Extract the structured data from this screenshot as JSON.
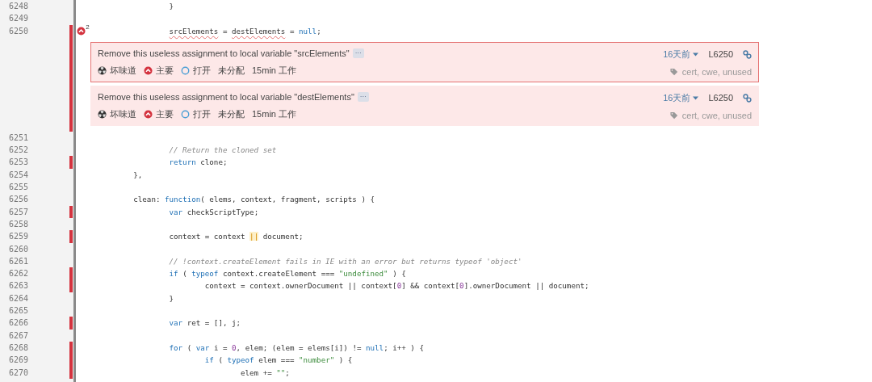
{
  "lines": [
    {
      "number": "6248",
      "uncovered": false,
      "tokens": [
        {
          "kind": "plain",
          "text": "\t\t}"
        }
      ]
    },
    {
      "number": "6249",
      "uncovered": false
    },
    {
      "number": "6250",
      "uncovered": true,
      "issue_count": "2",
      "tokens": [
        {
          "kind": "issue",
          "text": "\t\tsrcElements"
        },
        {
          "kind": "plain",
          "text": " = "
        },
        {
          "kind": "issue",
          "text": "destElements"
        },
        {
          "kind": "plain",
          "text": " = "
        },
        {
          "kind": "keyword",
          "text": "null"
        },
        {
          "kind": "plain",
          "text": ";"
        }
      ],
      "issues": [
        {
          "selected": true,
          "message": "Remove this useless assignment to local variable \"srcElements\"",
          "more": "···",
          "type": "坏味道",
          "severity": "主要",
          "status": "打开",
          "assignee": "未分配",
          "effort": "15min 工作",
          "age": "16天前",
          "line": "L6250",
          "tags": "cert, cwe, unused"
        },
        {
          "selected": false,
          "message": "Remove this useless assignment to local variable \"destElements\"",
          "more": "···",
          "type": "坏味道",
          "severity": "主要",
          "status": "打开",
          "assignee": "未分配",
          "effort": "15min 工作",
          "age": "16天前",
          "line": "L6250",
          "tags": "cert, cwe, unused"
        }
      ]
    },
    {
      "number": "6251",
      "uncovered": false
    },
    {
      "number": "6252",
      "uncovered": false,
      "tokens": [
        {
          "kind": "comment",
          "text": "\t\t// Return the cloned set"
        }
      ]
    },
    {
      "number": "6253",
      "uncovered": true,
      "tokens": [
        {
          "kind": "keyword",
          "text": "\t\treturn"
        },
        {
          "kind": "plain",
          "text": " clone;"
        }
      ]
    },
    {
      "number": "6254",
      "uncovered": false,
      "tokens": [
        {
          "kind": "plain",
          "text": "\t},"
        }
      ]
    },
    {
      "number": "6255",
      "uncovered": false
    },
    {
      "number": "6256",
      "uncovered": false,
      "tokens": [
        {
          "kind": "plain",
          "text": "\tclean: "
        },
        {
          "kind": "keyword",
          "text": "function"
        },
        {
          "kind": "plain",
          "text": "( elems, context, fragment, scripts ) {"
        }
      ]
    },
    {
      "number": "6257",
      "uncovered": true,
      "tokens": [
        {
          "kind": "keyword",
          "text": "\t\tvar"
        },
        {
          "kind": "plain",
          "text": " checkScriptType;"
        }
      ]
    },
    {
      "number": "6258",
      "uncovered": false
    },
    {
      "number": "6259",
      "uncovered": true,
      "tokens": [
        {
          "kind": "plain",
          "text": "\t\tcontext = context "
        },
        {
          "kind": "highlight",
          "text": "||"
        },
        {
          "kind": "plain",
          "text": " document;"
        }
      ]
    },
    {
      "number": "6260",
      "uncovered": false
    },
    {
      "number": "6261",
      "uncovered": false,
      "tokens": [
        {
          "kind": "comment",
          "text": "\t\t// !context.createElement fails in IE with an error but returns typeof 'object'"
        }
      ]
    },
    {
      "number": "6262",
      "uncovered": true,
      "tokens": [
        {
          "kind": "keyword",
          "text": "\t\tif"
        },
        {
          "kind": "plain",
          "text": " ( "
        },
        {
          "kind": "keyword",
          "text": "typeof"
        },
        {
          "kind": "plain",
          "text": " context.createElement === "
        },
        {
          "kind": "string",
          "text": "\"undefined\""
        },
        {
          "kind": "plain",
          "text": " ) {"
        }
      ]
    },
    {
      "number": "6263",
      "uncovered": true,
      "tokens": [
        {
          "kind": "plain",
          "text": "\t\t\tcontext = context.ownerDocument || context["
        },
        {
          "kind": "number",
          "text": "0"
        },
        {
          "kind": "plain",
          "text": "] && context["
        },
        {
          "kind": "number",
          "text": "0"
        },
        {
          "kind": "plain",
          "text": "].ownerDocument || document;"
        }
      ]
    },
    {
      "number": "6264",
      "uncovered": false,
      "tokens": [
        {
          "kind": "plain",
          "text": "\t\t}"
        }
      ]
    },
    {
      "number": "6265",
      "uncovered": false
    },
    {
      "number": "6266",
      "uncovered": true,
      "tokens": [
        {
          "kind": "keyword",
          "text": "\t\tvar"
        },
        {
          "kind": "plain",
          "text": " ret = [], j;"
        }
      ]
    },
    {
      "number": "6267",
      "uncovered": false
    },
    {
      "number": "6268",
      "uncovered": true,
      "tokens": [
        {
          "kind": "keyword",
          "text": "\t\tfor"
        },
        {
          "kind": "plain",
          "text": " ( "
        },
        {
          "kind": "keyword",
          "text": "var"
        },
        {
          "kind": "plain",
          "text": " i = "
        },
        {
          "kind": "number",
          "text": "0"
        },
        {
          "kind": "plain",
          "text": ", elem; (elem = elems[i]) != "
        },
        {
          "kind": "keyword",
          "text": "null"
        },
        {
          "kind": "plain",
          "text": "; i++ ) {"
        }
      ]
    },
    {
      "number": "6269",
      "uncovered": true,
      "tokens": [
        {
          "kind": "keyword",
          "text": "\t\t\tif"
        },
        {
          "kind": "plain",
          "text": " ( "
        },
        {
          "kind": "keyword",
          "text": "typeof"
        },
        {
          "kind": "plain",
          "text": " elem === "
        },
        {
          "kind": "string",
          "text": "\"number\""
        },
        {
          "kind": "plain",
          "text": " ) {"
        }
      ]
    },
    {
      "number": "6270",
      "uncovered": true,
      "tokens": [
        {
          "kind": "plain",
          "text": "\t\t\t\telem += "
        },
        {
          "kind": "string",
          "text": "\"\""
        },
        {
          "kind": "plain",
          "text": ";"
        }
      ]
    }
  ]
}
